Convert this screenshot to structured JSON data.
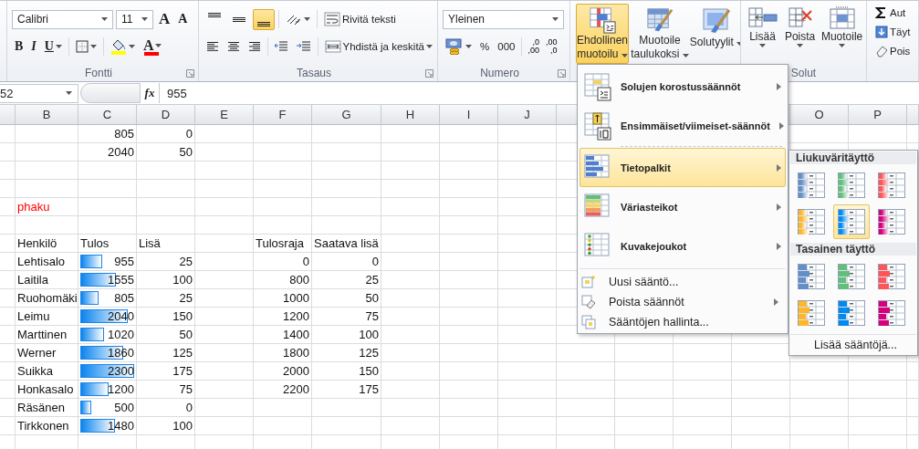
{
  "ribbon": {
    "font_group": {
      "label": "Fontti",
      "font": "Calibri",
      "size": "11",
      "grow": "A",
      "shrink": "A",
      "bold": "B",
      "italic": "I",
      "underline": "U",
      "font_color": "A"
    },
    "alignment_group": {
      "label": "Tasaus",
      "vertical": [
        {
          "kind": "top",
          "selected": false
        },
        {
          "kind": "middle",
          "selected": false
        },
        {
          "kind": "bottom",
          "selected": true
        }
      ],
      "wrap": "Rivitä teksti",
      "merge": "Yhdistä ja keskitä"
    },
    "number_group": {
      "label": "Numero",
      "format": "Yleinen",
      "percent": "%",
      "thousands": "000",
      "decimals": [
        {
          "top": ",0",
          "bottom": ",00"
        },
        {
          "top": ",00",
          "bottom": ",0"
        }
      ]
    },
    "styles_group": {
      "buttons": [
        {
          "kind": "conditional",
          "lines": [
            "Ehdollinen",
            "muotoilu"
          ],
          "selected": true
        },
        {
          "kind": "table",
          "lines": [
            "Muotoile",
            "taulukoksi"
          ],
          "selected": false
        },
        {
          "kind": "cellstyles",
          "lines": [
            "Solutyylit"
          ],
          "selected": false
        }
      ]
    },
    "cells_group": {
      "label": "Solut",
      "buttons": [
        {
          "kind": "insert",
          "label": "Lisää"
        },
        {
          "kind": "delete",
          "label": "Poista"
        },
        {
          "kind": "format",
          "label": "Muotoile"
        }
      ]
    },
    "editing_group": {
      "items": [
        {
          "kind": "sum",
          "label": "Aut"
        },
        {
          "kind": "fill",
          "label": "Täyt"
        },
        {
          "kind": "clear",
          "label": "Pois"
        }
      ]
    }
  },
  "formula_bar": {
    "name_box": "52",
    "fx": "fx",
    "value": "955"
  },
  "sheet": {
    "columns": [
      "B",
      "C",
      "D",
      "E",
      "F",
      "G",
      "H",
      "I",
      "J",
      "O",
      "P"
    ],
    "rows": [
      {
        "kind": "number",
        "tulos": "805",
        "lisa": "0"
      },
      {
        "kind": "number",
        "tulos": "2040",
        "lisa": "50"
      },
      {
        "kind": "blank"
      },
      {
        "kind": "blank"
      },
      {
        "kind": "note",
        "person": "phaku"
      },
      {
        "kind": "blank"
      },
      {
        "kind": "header",
        "person": "Henkilö",
        "tulos": "Tulos",
        "lisa": "Lisä",
        "raja": "Tulosraja",
        "saatava": "Saatava lisä"
      },
      {
        "kind": "number",
        "person": "Lehtisalo",
        "tulos": "955",
        "level": 0.4,
        "lisa": "25",
        "raja": "0",
        "saatava": "0"
      },
      {
        "kind": "number",
        "person": "Laitila",
        "tulos": "1555",
        "level": 0.66,
        "lisa": "100",
        "raja": "800",
        "saatava": "25"
      },
      {
        "kind": "number",
        "person": "Ruohomäki",
        "tulos": "805",
        "level": 0.34,
        "lisa": "25",
        "raja": "1000",
        "saatava": "50"
      },
      {
        "kind": "number",
        "person": "Leimu",
        "tulos": "2040",
        "level": 0.88,
        "lisa": "150",
        "raja": "1200",
        "saatava": "75"
      },
      {
        "kind": "number",
        "person": "Marttinen",
        "tulos": "1020",
        "level": 0.44,
        "lisa": "50",
        "raja": "1400",
        "saatava": "100"
      },
      {
        "kind": "number",
        "person": "Werner",
        "tulos": "1860",
        "level": 0.8,
        "lisa": "125",
        "raja": "1800",
        "saatava": "125"
      },
      {
        "kind": "number",
        "person": "Suikka",
        "tulos": "2300",
        "level": 1.0,
        "lisa": "175",
        "raja": "2000",
        "saatava": "150"
      },
      {
        "kind": "number",
        "person": "Honkasalo",
        "tulos": "1200",
        "level": 0.52,
        "lisa": "75",
        "raja": "2200",
        "saatava": "175"
      },
      {
        "kind": "number",
        "person": "Räsänen",
        "tulos": "500",
        "level": 0.2,
        "lisa": "0"
      },
      {
        "kind": "number",
        "person": "Tirkkonen",
        "tulos": "1480",
        "level": 0.64,
        "lisa": "100"
      },
      {
        "kind": "blank"
      }
    ]
  },
  "menu": {
    "items": [
      {
        "kind": "highlight",
        "label": "Solujen korostussäännöt",
        "submenu": true,
        "selected": false
      },
      {
        "kind": "topbottom",
        "label": "Ensimmäiset/viimeiset-säännöt",
        "submenu": true,
        "selected": false
      },
      {
        "kind": "databars",
        "label": "Tietopalkit",
        "submenu": true,
        "selected": true
      },
      {
        "kind": "colorscales",
        "label": "Väriasteikot",
        "submenu": true,
        "selected": false
      },
      {
        "kind": "iconsets",
        "label": "Kuvakejoukot",
        "submenu": true,
        "selected": false
      }
    ],
    "commands": [
      {
        "kind": "new",
        "label": "Uusi sääntö...",
        "submenu": false
      },
      {
        "kind": "clear",
        "label": "Poista säännöt",
        "submenu": true
      },
      {
        "kind": "manage",
        "label": "Sääntöjen hallinta...",
        "submenu": false
      }
    ]
  },
  "submenu": {
    "sections": [
      {
        "kind": "gradient",
        "title": "Liukuväritäyttö",
        "tiles": [
          {
            "color": "#638ec6",
            "selected": false
          },
          {
            "color": "#63be7b",
            "selected": false
          },
          {
            "color": "#ff555a",
            "selected": false
          },
          {
            "color": "#ffb628",
            "selected": false
          },
          {
            "color": "#008aef",
            "selected": true
          },
          {
            "color": "#d6007b",
            "selected": false
          }
        ]
      },
      {
        "kind": "solid",
        "title": "Tasainen täyttö",
        "tiles": [
          {
            "color": "#638ec6",
            "selected": false
          },
          {
            "color": "#63be7b",
            "selected": false
          },
          {
            "color": "#ff555a",
            "selected": false
          },
          {
            "color": "#ffb628",
            "selected": false
          },
          {
            "color": "#008aef",
            "selected": false
          },
          {
            "color": "#d6007b",
            "selected": false
          }
        ]
      }
    ],
    "more": "Lisää sääntöjä..."
  }
}
